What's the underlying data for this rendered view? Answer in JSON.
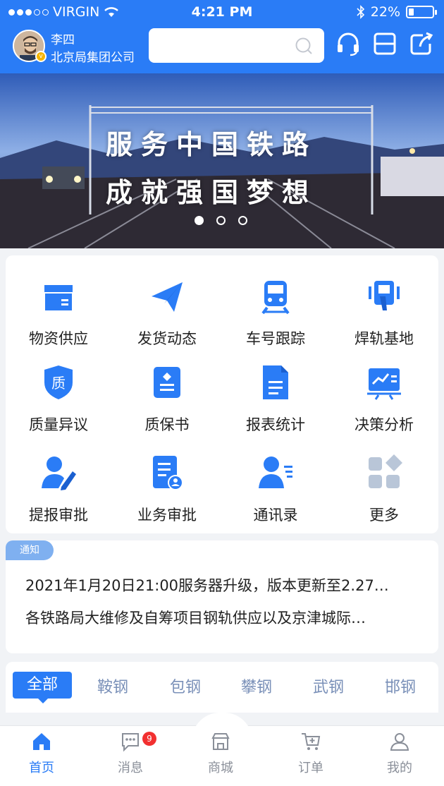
{
  "status_bar": {
    "carrier": "VIRGIN",
    "time": "4:21 PM",
    "battery": "22%",
    "battery_level": 0.22
  },
  "header": {
    "user_name": "李四",
    "org_name": "北京局集团公司",
    "search_placeholder": ""
  },
  "banner": {
    "line1": "服务中国铁路",
    "line2": "成就强国梦想",
    "page_count": 3,
    "active_page": 1
  },
  "grid": [
    {
      "label": "物资供应",
      "icon": "box-icon"
    },
    {
      "label": "发货动态",
      "icon": "paper-plane-icon"
    },
    {
      "label": "车号跟踪",
      "icon": "train-icon"
    },
    {
      "label": "焊轨基地",
      "icon": "welding-icon"
    },
    {
      "label": "质量异议",
      "icon": "quality-shield-icon"
    },
    {
      "label": "质保书",
      "icon": "certificate-icon"
    },
    {
      "label": "报表统计",
      "icon": "document-icon"
    },
    {
      "label": "决策分析",
      "icon": "chart-board-icon"
    },
    {
      "label": "提报审批",
      "icon": "user-edit-icon"
    },
    {
      "label": "业务审批",
      "icon": "doc-user-icon"
    },
    {
      "label": "通讯录",
      "icon": "contacts-icon"
    },
    {
      "label": "更多",
      "icon": "more-grid-icon"
    }
  ],
  "notice": {
    "tag": "通知",
    "items": [
      "2021年1月20日21:00服务器升级，版本更新至2.27…",
      "各铁路局大维修及自筹项目钢轨供应以及京津城际…"
    ]
  },
  "tabs": [
    "全部",
    "鞍钢",
    "包钢",
    "攀钢",
    "武钢",
    "邯钢"
  ],
  "bottom_nav": [
    {
      "label": "首页",
      "icon": "home-icon"
    },
    {
      "label": "消息",
      "icon": "message-icon",
      "badge": "9"
    },
    {
      "label": "商城",
      "icon": "store-icon"
    },
    {
      "label": "订单",
      "icon": "cart-icon"
    },
    {
      "label": "我的",
      "icon": "profile-icon"
    }
  ],
  "colors": {
    "primary": "#2a7cf6",
    "badge": "#f23030",
    "tag": "#7fb0f0"
  }
}
